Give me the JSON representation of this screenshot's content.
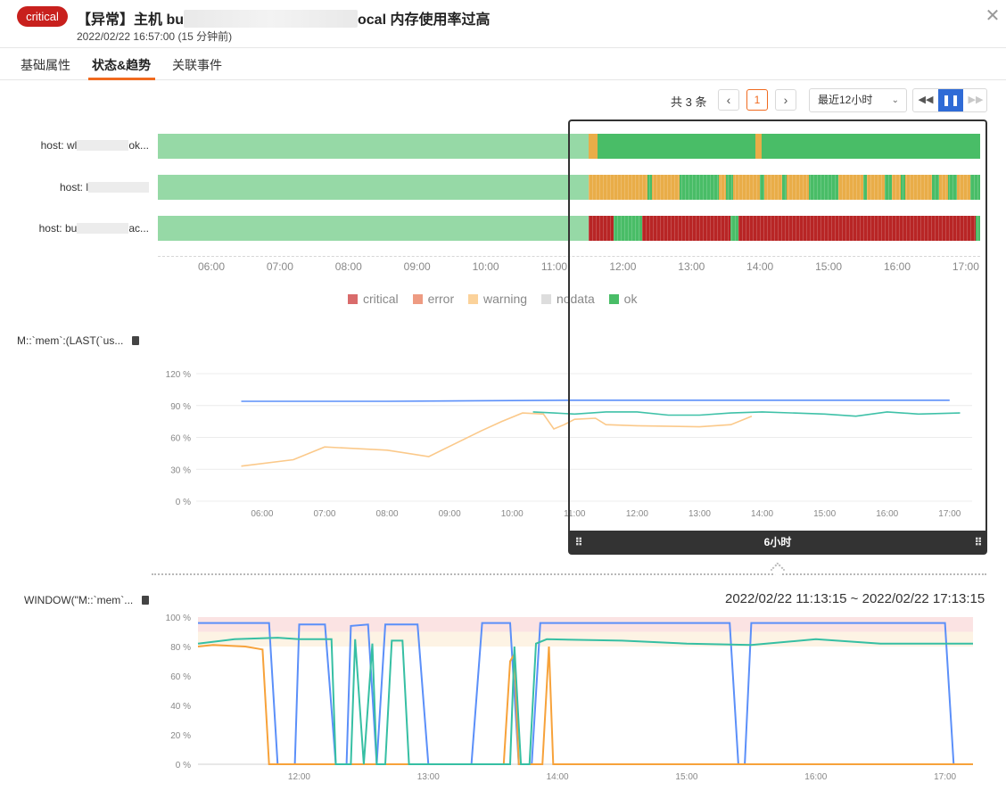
{
  "header": {
    "severity": "critical",
    "title_prefix": "【异常】主机 bu",
    "title_suffix": "ocal 内存使用率过高",
    "subtitle": "2022/02/22 16:57:00 (15 分钟前)",
    "close": "✕"
  },
  "tabs": [
    {
      "label": "基础属性",
      "active": false
    },
    {
      "label": "状态&趋势",
      "active": true
    },
    {
      "label": "关联事件",
      "active": false
    }
  ],
  "toolbar": {
    "total": "共 3 条",
    "prev": "‹",
    "page": "1",
    "next": "›",
    "range": "最近12小时",
    "caret": "⌄",
    "rewind": "◀◀",
    "pause": "❚❚",
    "forward": "▶▶"
  },
  "status_rows": [
    {
      "prefix": "host: wl",
      "suffix": "ok..."
    },
    {
      "prefix": "host: l",
      "suffix": ""
    },
    {
      "prefix": "host: bu",
      "suffix": "ac..."
    }
  ],
  "time_ticks": [
    "06:00",
    "07:00",
    "08:00",
    "09:00",
    "10:00",
    "11:00",
    "12:00",
    "13:00",
    "14:00",
    "15:00",
    "16:00",
    "17:00"
  ],
  "legend": [
    {
      "label": "critical",
      "color": "#d96b6b"
    },
    {
      "label": "error",
      "color": "#ee9b82"
    },
    {
      "label": "warning",
      "color": "#fbd29a"
    },
    {
      "label": "nodata",
      "color": "#dddddd"
    },
    {
      "label": "ok",
      "color": "#49bd67"
    }
  ],
  "chart1": {
    "title": "M::`mem`:(LAST(`us...",
    "y_ticks": [
      "120 %",
      "90 %",
      "60 %",
      "30 %",
      "0 %"
    ]
  },
  "selection": {
    "label": "6小时",
    "grip": "⠿"
  },
  "chart2": {
    "title": "WINDOW(\"M::`mem`...",
    "range": "2022/02/22 11:13:15 ~ 2022/02/22 17:13:15",
    "y_ticks": [
      "100 %",
      "80 %",
      "60 %",
      "40 %",
      "20 %",
      "0 %"
    ],
    "x_ticks": [
      "12:00",
      "13:00",
      "14:00",
      "15:00",
      "16:00",
      "17:00"
    ]
  },
  "chart_data": [
    {
      "type": "line",
      "title": "M::`mem`:(LAST(`us...",
      "ylim": [
        0,
        120
      ],
      "x_ticks": [
        "06:00",
        "07:00",
        "08:00",
        "09:00",
        "10:00",
        "11:00",
        "12:00",
        "13:00",
        "14:00",
        "15:00",
        "16:00",
        "17:00"
      ],
      "series": [
        {
          "color": "#5b8ff9",
          "points": [
            [
              "05:40",
              94
            ],
            [
              "08:00",
              94
            ],
            [
              "11:00",
              95
            ],
            [
              "14:00",
              95
            ],
            [
              "17:00",
              95
            ]
          ]
        },
        {
          "color": "#fbc98a",
          "points": [
            [
              "05:40",
              33
            ],
            [
              "06:30",
              39
            ],
            [
              "07:00",
              51
            ],
            [
              "08:00",
              48
            ],
            [
              "08:40",
              42
            ],
            [
              "09:30",
              66
            ],
            [
              "09:50",
              75
            ],
            [
              "10:10",
              83
            ],
            [
              "10:30",
              82
            ],
            [
              "10:40",
              68
            ],
            [
              "10:50",
              72
            ],
            [
              "11:00",
              77
            ],
            [
              "11:20",
              78
            ],
            [
              "11:30",
              72
            ],
            [
              "12:00",
              71
            ],
            [
              "13:00",
              70
            ],
            [
              "13:30",
              72
            ],
            [
              "13:50",
              80
            ]
          ]
        },
        {
          "color": "#3fc1a8",
          "points": [
            [
              "10:20",
              84
            ],
            [
              "10:40",
              83
            ],
            [
              "11:00",
              82
            ],
            [
              "11:30",
              84
            ],
            [
              "12:00",
              84
            ],
            [
              "12:30",
              81
            ],
            [
              "13:00",
              81
            ],
            [
              "13:30",
              83
            ],
            [
              "14:00",
              84
            ],
            [
              "15:00",
              82
            ],
            [
              "15:30",
              80
            ],
            [
              "16:00",
              84
            ],
            [
              "16:30",
              82
            ],
            [
              "17:10",
              83
            ]
          ]
        }
      ]
    },
    {
      "type": "line",
      "title": "WINDOW(\"M::`mem`...",
      "ylim": [
        0,
        100
      ],
      "x_ticks": [
        "12:00",
        "13:00",
        "14:00",
        "15:00",
        "16:00",
        "17:00"
      ],
      "series": [
        {
          "color": "#5b8ff9",
          "points": [
            [
              "11:13",
              96
            ],
            [
              "11:46",
              96
            ],
            [
              "11:50",
              0
            ],
            [
              "11:58",
              0
            ],
            [
              "12:00",
              95
            ],
            [
              "12:12",
              95
            ],
            [
              "12:17",
              0
            ],
            [
              "12:22",
              0
            ],
            [
              "12:24",
              94
            ],
            [
              "12:32",
              95
            ],
            [
              "12:36",
              0
            ],
            [
              "12:40",
              95
            ],
            [
              "12:55",
              95
            ],
            [
              "13:00",
              0
            ],
            [
              "13:10",
              0
            ],
            [
              "13:20",
              0
            ],
            [
              "13:25",
              96
            ],
            [
              "13:38",
              96
            ],
            [
              "13:42",
              0
            ],
            [
              "13:48",
              0
            ],
            [
              "13:52",
              96
            ],
            [
              "15:20",
              96
            ],
            [
              "15:24",
              0
            ],
            [
              "15:27",
              0
            ],
            [
              "15:30",
              96
            ],
            [
              "17:00",
              96
            ],
            [
              "17:04",
              0
            ]
          ]
        },
        {
          "color": "#f7a23a",
          "points": [
            [
              "11:13",
              80
            ],
            [
              "11:20",
              81
            ],
            [
              "11:35",
              80
            ],
            [
              "11:43",
              78
            ],
            [
              "11:46",
              0
            ],
            [
              "13:35",
              0
            ],
            [
              "13:38",
              70
            ],
            [
              "13:40",
              75
            ],
            [
              "13:42",
              0
            ],
            [
              "13:47",
              0
            ],
            [
              "13:48",
              0
            ],
            [
              "13:53",
              0
            ],
            [
              "13:56",
              80
            ],
            [
              "13:58",
              0
            ],
            [
              "17:13",
              0
            ]
          ]
        },
        {
          "color": "#36bfa3",
          "points": [
            [
              "11:13",
              82
            ],
            [
              "11:30",
              85
            ],
            [
              "11:50",
              86
            ],
            [
              "12:00",
              85
            ],
            [
              "12:15",
              85
            ],
            [
              "12:17",
              0
            ],
            [
              "12:24",
              0
            ],
            [
              "12:26",
              85
            ],
            [
              "12:30",
              0
            ],
            [
              "12:34",
              82
            ],
            [
              "12:36",
              0
            ],
            [
              "12:40",
              0
            ],
            [
              "12:43",
              84
            ],
            [
              "12:48",
              84
            ],
            [
              "12:51",
              0
            ],
            [
              "13:38",
              0
            ],
            [
              "13:40",
              80
            ],
            [
              "13:43",
              0
            ],
            [
              "13:47",
              0
            ],
            [
              "13:50",
              82
            ],
            [
              "13:55",
              85
            ],
            [
              "14:30",
              84
            ],
            [
              "15:00",
              82
            ],
            [
              "15:30",
              81
            ],
            [
              "16:00",
              85
            ],
            [
              "16:30",
              82
            ],
            [
              "17:13",
              82
            ]
          ]
        }
      ]
    }
  ]
}
